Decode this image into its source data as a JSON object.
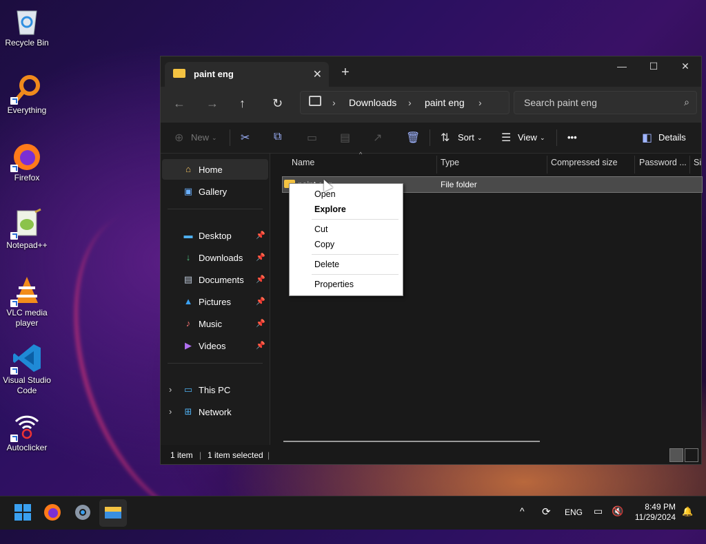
{
  "desktop": {
    "icons": [
      {
        "label": "Recycle Bin",
        "icon": "recycle-bin-icon"
      },
      {
        "label": "Everything",
        "icon": "everything-search-icon"
      },
      {
        "label": "Firefox",
        "icon": "firefox-icon"
      },
      {
        "label": "Notepad++",
        "icon": "notepadpp-icon"
      },
      {
        "label": "VLC media player",
        "icon": "vlc-icon"
      },
      {
        "label": "Visual Studio Code",
        "icon": "vscode-icon"
      },
      {
        "label": "Autoclicker",
        "icon": "autoclicker-icon"
      }
    ]
  },
  "window": {
    "tab_title": "paint eng",
    "tab_close": "✕",
    "new_tab": "+",
    "minimize": "—",
    "maximize": "☐",
    "close": "✕",
    "breadcrumb": [
      "Downloads",
      "paint eng"
    ],
    "search_placeholder": "Search paint eng",
    "toolbar": {
      "new": "New",
      "sort": "Sort",
      "view": "View",
      "more": "•••",
      "details": "Details"
    },
    "sidebar": {
      "items": [
        {
          "label": "Home",
          "icon": "home-icon",
          "pinned": false
        },
        {
          "label": "Gallery",
          "icon": "gallery-icon",
          "pinned": false
        },
        {
          "label": "Desktop",
          "icon": "desktop-icon",
          "pinned": true
        },
        {
          "label": "Downloads",
          "icon": "download-icon",
          "pinned": true
        },
        {
          "label": "Documents",
          "icon": "documents-icon",
          "pinned": true
        },
        {
          "label": "Pictures",
          "icon": "pictures-icon",
          "pinned": true
        },
        {
          "label": "Music",
          "icon": "music-icon",
          "pinned": true
        },
        {
          "label": "Videos",
          "icon": "videos-icon",
          "pinned": true
        },
        {
          "label": "This PC",
          "icon": "pc-icon",
          "pinned": false
        },
        {
          "label": "Network",
          "icon": "network-icon",
          "pinned": false
        }
      ]
    },
    "columns": [
      "Name",
      "Type",
      "Compressed size",
      "Password ...",
      "Si"
    ],
    "rows": [
      {
        "name": "paint eng",
        "type": "File folder"
      }
    ],
    "status": {
      "count": "1 item",
      "selected": "1 item selected"
    }
  },
  "context_menu": {
    "items": [
      "Open",
      "Explore",
      "Cut",
      "Copy",
      "Delete",
      "Properties"
    ]
  },
  "taskbar": {
    "language": "ENG",
    "time": "8:49 PM",
    "date": "11/29/2024"
  }
}
